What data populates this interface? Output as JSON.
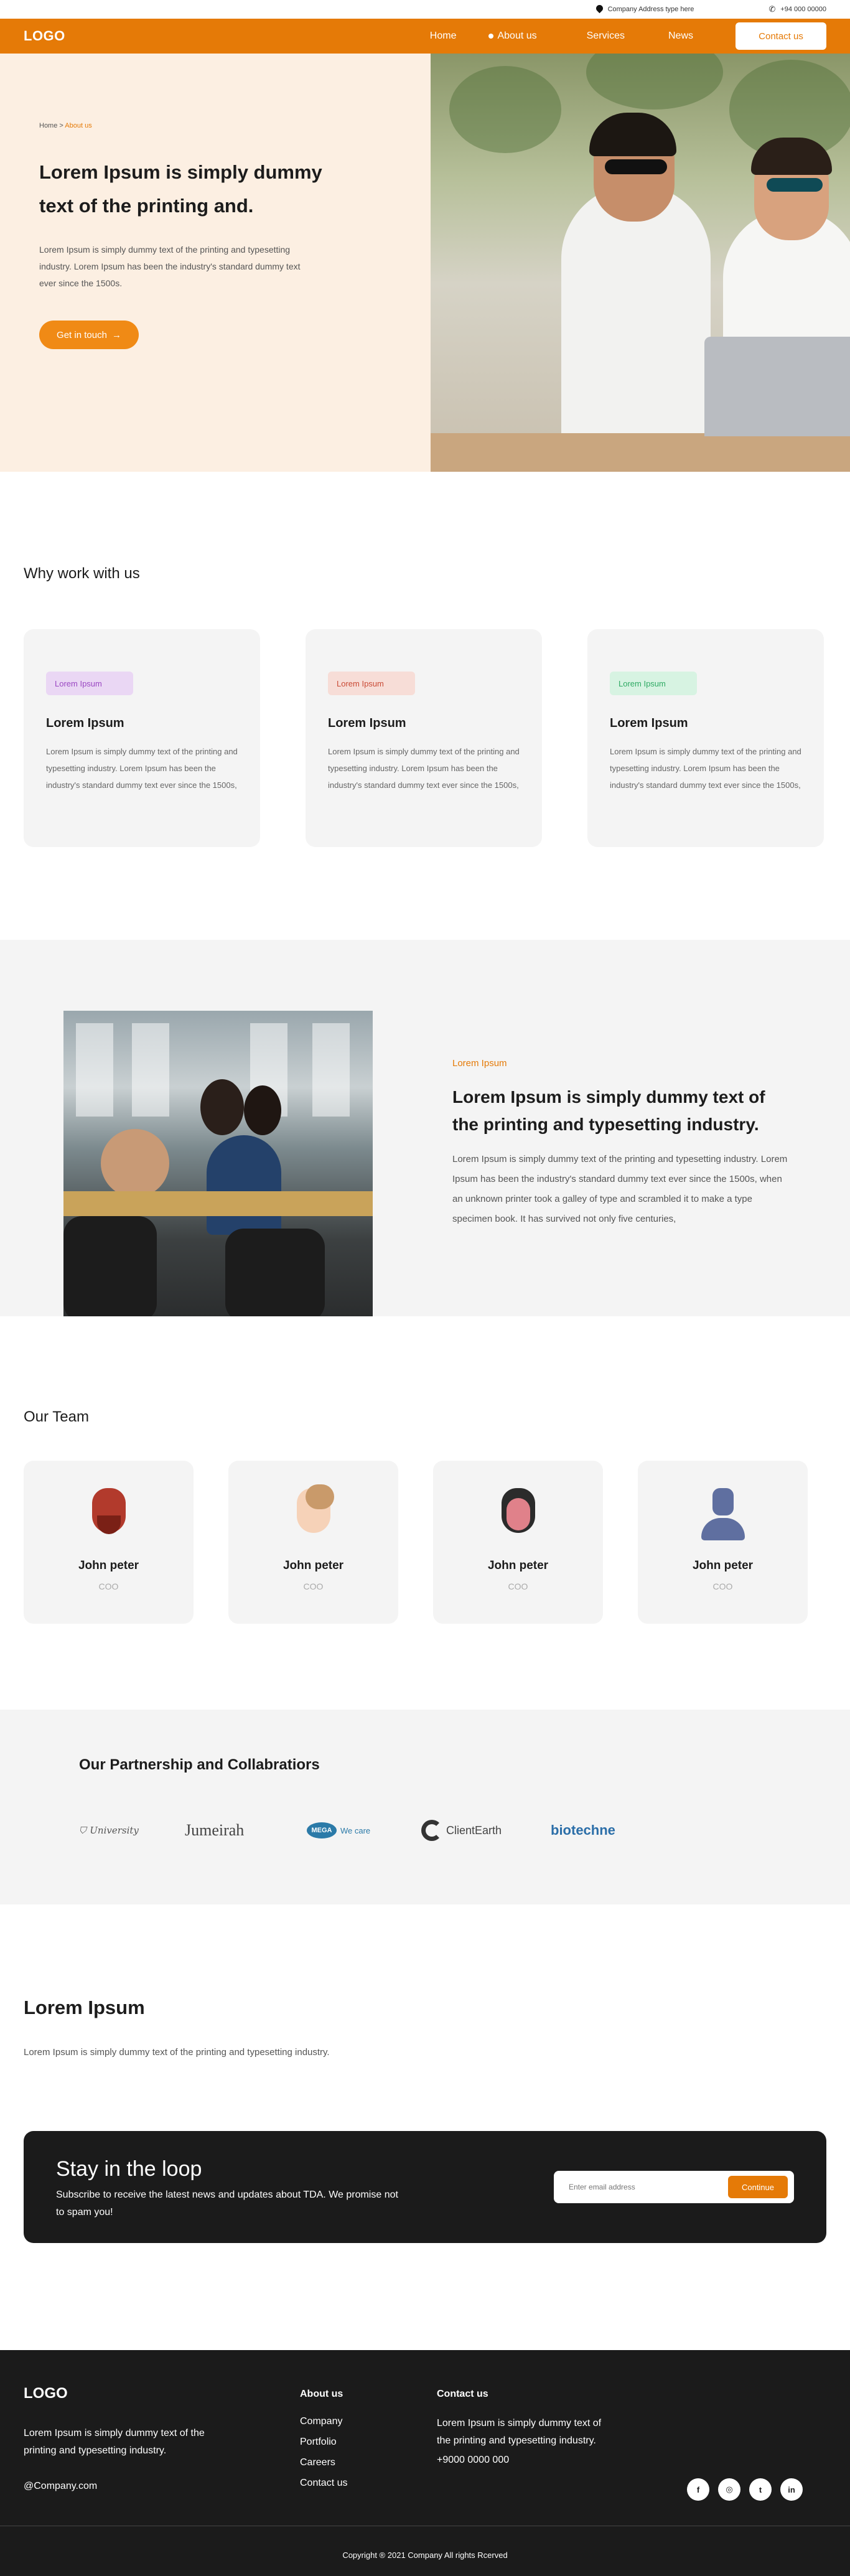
{
  "topbar": {
    "address": "Company Address type here",
    "phone": "+94 000 00000"
  },
  "nav": {
    "logo": "LOGO",
    "links": [
      "Home",
      "About us",
      "Services",
      "News"
    ],
    "cta": "Contact us"
  },
  "hero": {
    "breadcrumb_home": "Home",
    "breadcrumb_sep": " > ",
    "breadcrumb_current": "About us",
    "title": "Lorem Ipsum is simply dummy text of the printing and.",
    "body": "Lorem Ipsum is simply dummy text of the printing and typesetting industry. Lorem Ipsum has been the industry's standard dummy text ever since the 1500s.",
    "button": "Get in touch",
    "button_icon": "→"
  },
  "why": {
    "title": "Why work with us",
    "cards": [
      {
        "tag": "Lorem Ipsum",
        "heading": "Lorem Ipsum",
        "body": "Lorem Ipsum is simply dummy text of the printing and typesetting industry. Lorem Ipsum has been the industry's standard dummy text ever since the 1500s,"
      },
      {
        "tag": "Lorem Ipsum",
        "heading": "Lorem Ipsum",
        "body": "Lorem Ipsum is simply dummy text of the printing and typesetting industry. Lorem Ipsum has been the industry's standard dummy text ever since the 1500s,"
      },
      {
        "tag": "Lorem Ipsum",
        "heading": "Lorem Ipsum",
        "body": "Lorem Ipsum is simply dummy text of the printing and typesetting industry. Lorem Ipsum has been the industry's standard dummy text ever since the 1500s,"
      }
    ],
    "tag_colors": [
      "#9a47c2",
      "#c94a35",
      "#2faa64"
    ]
  },
  "feature": {
    "eyebrow": "Lorem Ipsum",
    "title": "Lorem Ipsum is simply dummy text of the printing and typesetting industry.",
    "body": "Lorem Ipsum is simply dummy text of the printing and typesetting industry. Lorem Ipsum has been the industry's standard dummy text ever since the 1500s, when an unknown printer took a galley of type and scrambled it to make a type specimen book. It has survived not only five centuries,"
  },
  "team": {
    "title": "Our Team",
    "members": [
      {
        "name": "John peter",
        "role": "COO"
      },
      {
        "name": "John peter",
        "role": "COO"
      },
      {
        "name": "John peter",
        "role": "COO"
      },
      {
        "name": "John peter",
        "role": "COO"
      }
    ]
  },
  "partners": {
    "title": "Our Partnership and Collabratiors",
    "logos": {
      "university": "University",
      "jumeirah": "Jumeirah",
      "mega": "MEGA",
      "mega_tag": "We care",
      "clientearth": "ClientEarth",
      "biotechne": "biotechne"
    }
  },
  "lorem": {
    "title": "Lorem Ipsum",
    "body": "Lorem Ipsum is simply dummy text of the printing and typesetting industry."
  },
  "newsletter": {
    "title": "Stay in the loop",
    "body": "Subscribe to receive the latest news and updates about TDA. We promise not to spam you!",
    "placeholder": "Enter email address",
    "button": "Continue"
  },
  "footer": {
    "logo": "LOGO",
    "desc": "Lorem Ipsum is simply dummy text of the printing and typesetting industry.",
    "email": "@Company.com",
    "about_title": "About us",
    "about_links": [
      "Company",
      "Portfolio",
      "Careers",
      "Contact us"
    ],
    "contact_title": "Contact us",
    "contact_desc": "Lorem Ipsum is simply dummy text of the printing and typesetting industry.",
    "contact_phone": "+9000 0000 000",
    "socials": [
      "f",
      "◎",
      "t",
      "in"
    ],
    "copyright": "Copyright ® 2021 Company All rights Rcerved"
  },
  "colors": {
    "accent": "#e57a07",
    "hero_bg": "#fcefe2",
    "dark": "#1b1b1b",
    "card": "#f4f4f4"
  }
}
